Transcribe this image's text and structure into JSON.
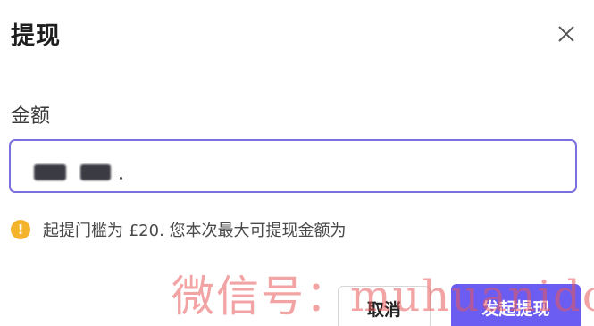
{
  "dialog": {
    "title": "提现",
    "close_icon": "close-icon"
  },
  "form": {
    "amount_label": "金额",
    "amount_value_redacted": true
  },
  "notice": {
    "icon": "warning-icon",
    "text": "起提门槛为 £20. 您本次最大可提现金额为"
  },
  "actions": {
    "cancel_label": "取消",
    "submit_label": "发起提现"
  },
  "watermark": {
    "text": "微信号：muhuanidc"
  },
  "colors": {
    "accent": "#6b5cf2",
    "input_border": "#7b6fe0",
    "warning": "#f3b42c",
    "watermark": "#e85a5a"
  }
}
